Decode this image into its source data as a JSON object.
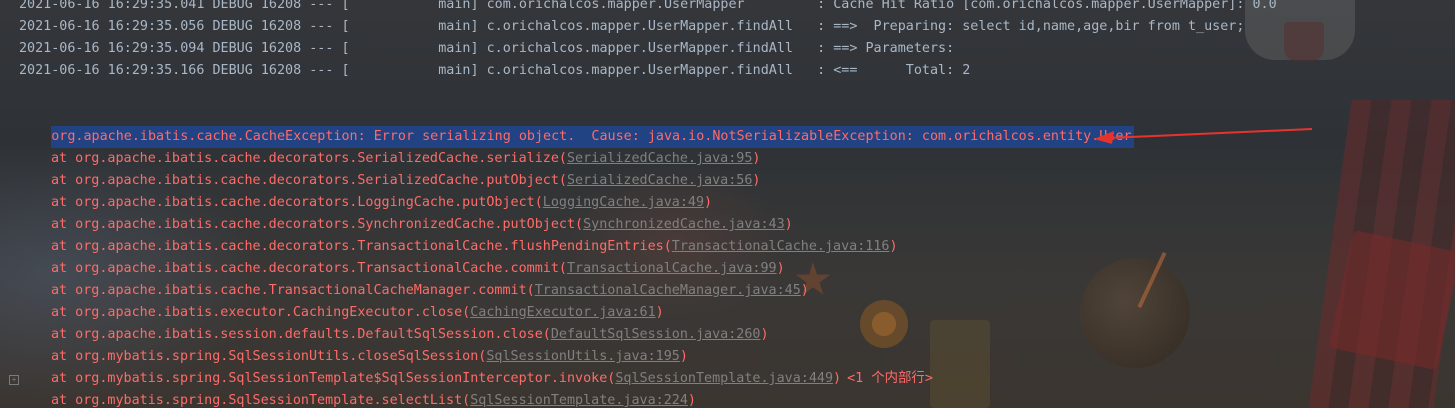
{
  "debug_lines": [
    "2021-06-16 16:29:35.041 DEBUG 16208 --- [           main] com.orichalcos.mapper.UserMapper         : Cache Hit Ratio [com.orichalcos.mapper.UserMapper]: 0.0",
    "2021-06-16 16:29:35.056 DEBUG 16208 --- [           main] c.orichalcos.mapper.UserMapper.findAll   : ==>  Preparing: select id,name,age,bir from t_user;",
    "2021-06-16 16:29:35.094 DEBUG 16208 --- [           main] c.orichalcos.mapper.UserMapper.findAll   : ==> Parameters: ",
    "2021-06-16 16:29:35.166 DEBUG 16208 --- [           main] c.orichalcos.mapper.UserMapper.findAll   : <==      Total: 2"
  ],
  "exception_line": "org.apache.ibatis.cache.CacheException: Error serializing object.  Cause: java.io.NotSerializableException: com.orichalcos.entity.User",
  "stack_frames": [
    {
      "prefix": "at org.apache.ibatis.cache.decorators.SerializedCache.serialize(",
      "link": "SerializedCache.java:95",
      "suffix": ")"
    },
    {
      "prefix": "at org.apache.ibatis.cache.decorators.SerializedCache.putObject(",
      "link": "SerializedCache.java:56",
      "suffix": ")"
    },
    {
      "prefix": "at org.apache.ibatis.cache.decorators.LoggingCache.putObject(",
      "link": "LoggingCache.java:49",
      "suffix": ")"
    },
    {
      "prefix": "at org.apache.ibatis.cache.decorators.SynchronizedCache.putObject(",
      "link": "SynchronizedCache.java:43",
      "suffix": ")"
    },
    {
      "prefix": "at org.apache.ibatis.cache.decorators.TransactionalCache.flushPendingEntries(",
      "link": "TransactionalCache.java:116",
      "suffix": ")"
    },
    {
      "prefix": "at org.apache.ibatis.cache.decorators.TransactionalCache.commit(",
      "link": "TransactionalCache.java:99",
      "suffix": ")"
    },
    {
      "prefix": "at org.apache.ibatis.cache.TransactionalCacheManager.commit(",
      "link": "TransactionalCacheManager.java:45",
      "suffix": ")"
    },
    {
      "prefix": "at org.apache.ibatis.executor.CachingExecutor.close(",
      "link": "CachingExecutor.java:61",
      "suffix": ")"
    },
    {
      "prefix": "at org.apache.ibatis.session.defaults.DefaultSqlSession.close(",
      "link": "DefaultSqlSession.java:260",
      "suffix": ")"
    },
    {
      "prefix": "at org.mybatis.spring.SqlSessionUtils.closeSqlSession(",
      "link": "SqlSessionUtils.java:195",
      "suffix": ")"
    },
    {
      "prefix": "at org.mybatis.spring.SqlSessionTemplate$SqlSessionInterceptor.invoke(",
      "link": "SqlSessionTemplate.java:449",
      "suffix": ")",
      "folded": "<1 个内部行>"
    },
    {
      "prefix": "at org.mybatis.spring.SqlSessionTemplate.selectList(",
      "link": "SqlSessionTemplate.java:224",
      "suffix": ")"
    }
  ],
  "colors": {
    "debug_text": "#a9b7c6",
    "error_text": "#ff6b68",
    "selection": "#214283",
    "link": "#808080",
    "annotation_arrow": "#e8332b"
  },
  "icons": {
    "fold_gutter": "fold-expand-icon",
    "annotation": "arrow-annotation-icon"
  }
}
